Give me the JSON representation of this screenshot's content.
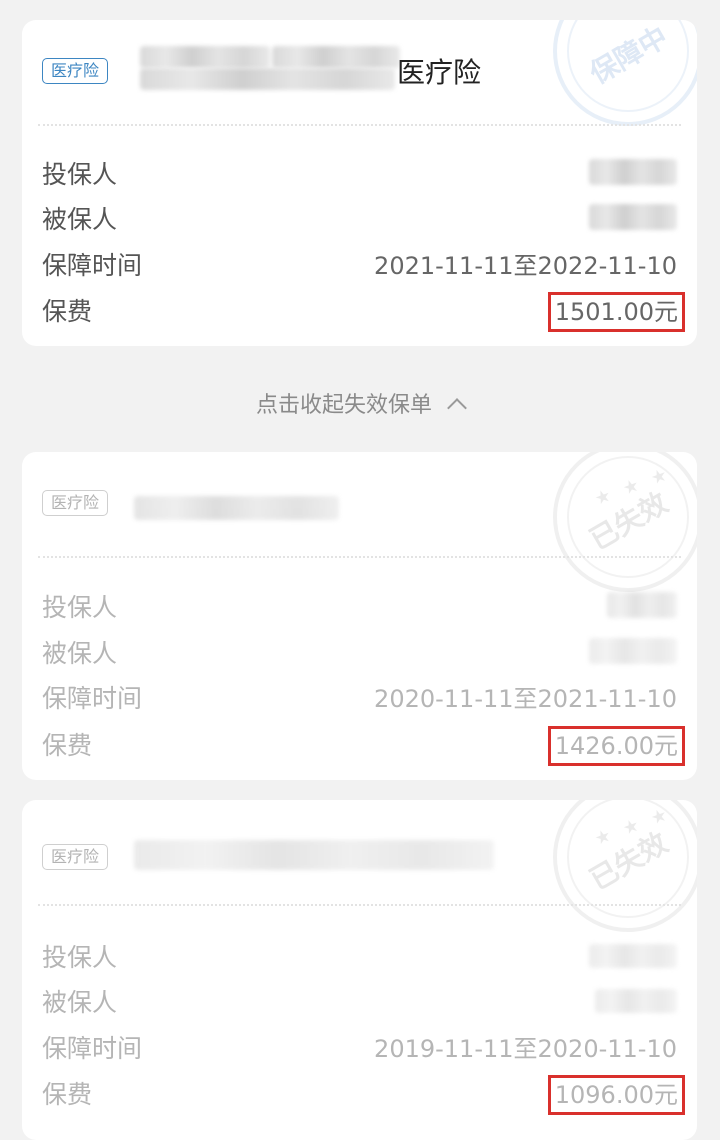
{
  "labels": {
    "policyholder": "投保人",
    "insured": "被保人",
    "coverage_period": "保障时间",
    "premium": "保费"
  },
  "collapse_label": "点击收起失效保单",
  "policies": [
    {
      "tag": "医疗险",
      "title_suffix": "医疗险",
      "coverage_period": "2021-11-11至2022-11-10",
      "premium": "1501.00元",
      "status_stamp": "保障中"
    },
    {
      "tag": "医疗险",
      "coverage_period": "2020-11-11至2021-11-10",
      "premium": "1426.00元",
      "status_stamp": "已失效"
    },
    {
      "tag": "医疗险",
      "coverage_period": "2019-11-11至2020-11-10",
      "premium": "1096.00元",
      "status_stamp": "已失效"
    }
  ],
  "colors": {
    "tag_active": "#3d86c2",
    "highlight_box": "#d9302c",
    "background": "#f2f2f2"
  }
}
